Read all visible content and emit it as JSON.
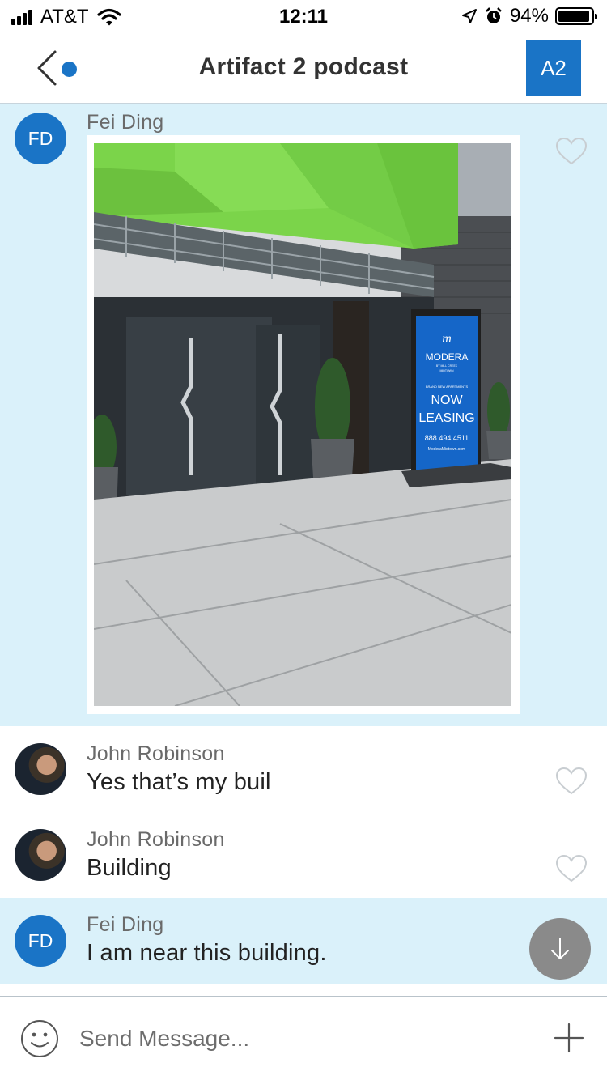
{
  "status_bar": {
    "carrier": "AT&T",
    "time": "12:11",
    "battery_percent": "94%",
    "battery_level": 0.94
  },
  "header": {
    "title": "Artifact 2 podcast",
    "group_avatar": "A2",
    "back_icon": "chevron-left-icon",
    "accent_color": "#1a74c6"
  },
  "messages": [
    {
      "sender": "Fei Ding",
      "avatar_initials": "FD",
      "type": "photo",
      "highlighted": true,
      "photo": {
        "sign_brand": "MODERA",
        "sign_subtitle_1": "BY MILL CREEK",
        "sign_subtitle_2": "MIDTOWN",
        "sign_tagline": "BRAND NEW APARTMENTS",
        "sign_line_1": "NOW",
        "sign_line_2": "LEASING",
        "sign_phone": "888.494.4511",
        "sign_web": "ModeraMidtown.com"
      }
    },
    {
      "sender": "John Robinson",
      "type": "text",
      "text": "Yes that’s my buil",
      "highlighted": false
    },
    {
      "sender": "John Robinson",
      "type": "text",
      "text": "Building",
      "highlighted": false
    },
    {
      "sender": "Fei Ding",
      "avatar_initials": "FD",
      "type": "text",
      "text": "I am near this building.",
      "highlighted": true
    }
  ],
  "composer": {
    "placeholder": "Send Message...",
    "emoji_icon": "smiley-icon",
    "add_icon": "plus-icon"
  },
  "colors": {
    "highlight_bg": "#daf1fa",
    "avatar_blue": "#1a74c6",
    "scroll_button": "#8a8a8a"
  }
}
